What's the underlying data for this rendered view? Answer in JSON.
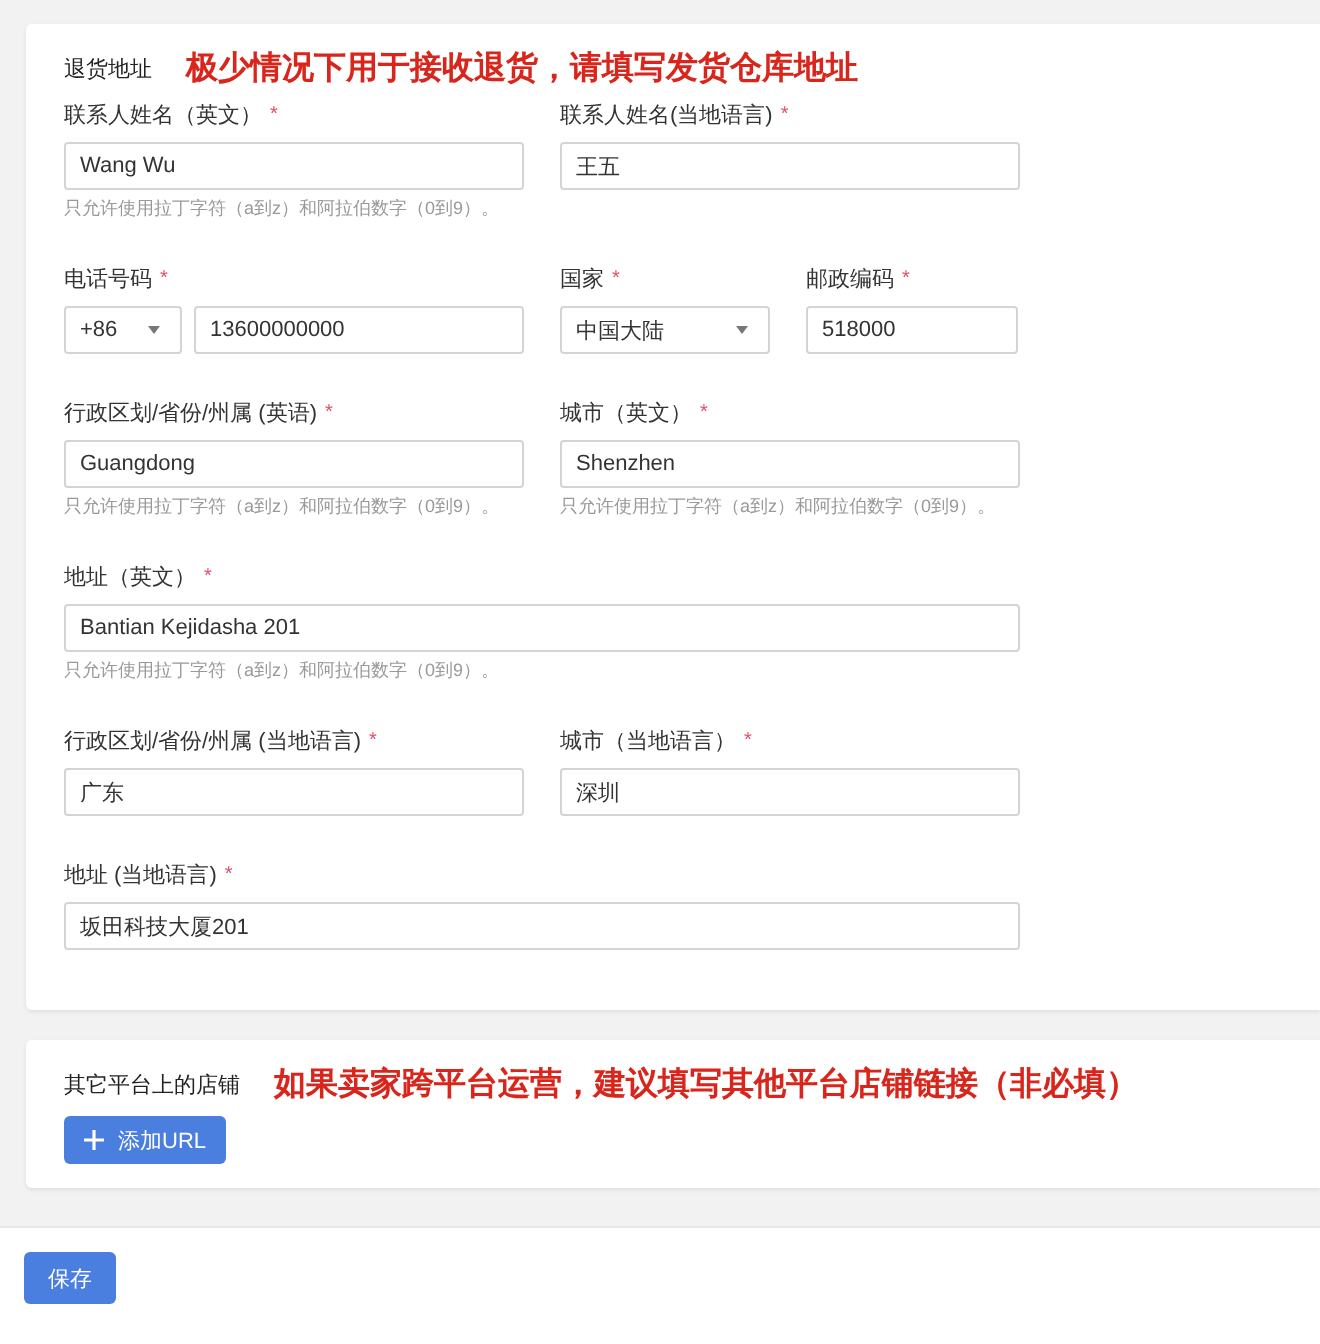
{
  "sections": [
    {
      "title": "退货地址",
      "note": "极少情况下用于接收退货，请填写发货仓库地址",
      "rows": [
        {
          "kind": "pair",
          "fields": [
            {
              "kind": "text",
              "label": "联系人姓名（英文）",
              "required_mark": "*",
              "value": "Wang Wu",
              "hint": "只允许使用拉丁字符（a到z）和阿拉伯数字（0到9）。"
            },
            {
              "kind": "text",
              "label": "联系人姓名(当地语言)",
              "required_mark": "*",
              "value": "王五"
            }
          ]
        },
        {
          "kind": "triple",
          "fields": [
            {
              "kind": "phone",
              "label": "电话号码",
              "required_mark": "*",
              "code": "+86",
              "value": "13600000000"
            },
            {
              "kind": "select",
              "label": "国家",
              "required_mark": "*",
              "value": "中国大陆"
            },
            {
              "kind": "text",
              "label": "邮政编码",
              "required_mark": "*",
              "value": "518000"
            }
          ]
        },
        {
          "kind": "pair",
          "fields": [
            {
              "kind": "text",
              "label": "行政区划/省份/州属 (英语)",
              "required_mark": "*",
              "value": "Guangdong",
              "hint": "只允许使用拉丁字符（a到z）和阿拉伯数字（0到9）。"
            },
            {
              "kind": "text",
              "label": "城市（英文）",
              "required_mark": "*",
              "value": "Shenzhen",
              "hint": "只允许使用拉丁字符（a到z）和阿拉伯数字（0到9）。"
            }
          ]
        },
        {
          "kind": "wide",
          "fields": [
            {
              "kind": "text",
              "label": "地址（英文）",
              "required_mark": "*",
              "value": "Bantian Kejidasha 201",
              "hint": "只允许使用拉丁字符（a到z）和阿拉伯数字（0到9）。"
            }
          ]
        },
        {
          "kind": "pair",
          "fields": [
            {
              "kind": "text",
              "label": "行政区划/省份/州属 (当地语言)",
              "required_mark": "*",
              "value": "广东"
            },
            {
              "kind": "text",
              "label": "城市（当地语言）",
              "required_mark": "*",
              "value": "深圳"
            }
          ]
        },
        {
          "kind": "wide",
          "fields": [
            {
              "kind": "text",
              "label": "地址 (当地语言)",
              "required_mark": "*",
              "value": "坂田科技大厦201"
            }
          ]
        }
      ]
    },
    {
      "title": "其它平台上的店铺",
      "note": "如果卖家跨平台运营，建议填写其他平台店铺链接（非必填）",
      "button": "添加URL"
    }
  ],
  "footer": {
    "button": "保存"
  }
}
